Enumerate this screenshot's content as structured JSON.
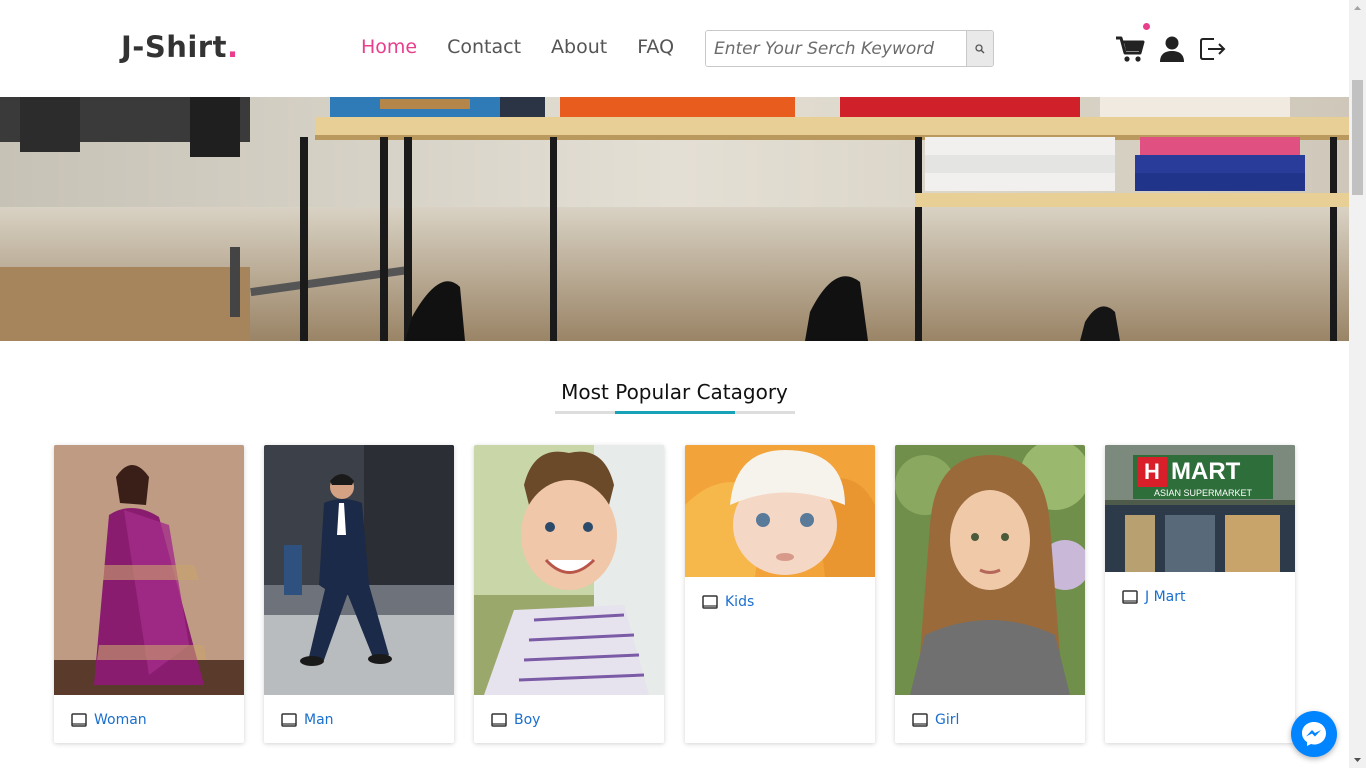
{
  "header": {
    "logo_text": "J-Shirt",
    "logo_dot": ".",
    "nav": [
      {
        "label": "Home",
        "active": true
      },
      {
        "label": "Contact",
        "active": false
      },
      {
        "label": "About",
        "active": false
      },
      {
        "label": "FAQ",
        "active": false
      }
    ],
    "search_placeholder": "Enter Your Serch Keyword",
    "icons": [
      "cart-icon",
      "user-icon",
      "logout-icon",
      "search-icon"
    ]
  },
  "section": {
    "title": "Most Popular Catagory"
  },
  "categories": [
    {
      "label": "Woman",
      "icon": "book-icon"
    },
    {
      "label": "Man",
      "icon": "book-icon"
    },
    {
      "label": "Boy",
      "icon": "book-icon"
    },
    {
      "label": "Kids",
      "icon": "book-icon"
    },
    {
      "label": "Girl",
      "icon": "book-icon"
    },
    {
      "label": "J Mart",
      "icon": "book-icon"
    }
  ],
  "store_sign": {
    "logo_letter": "H",
    "name": "MART",
    "tagline": "ASIAN SUPERMARKET"
  },
  "colors": {
    "accent_pink": "#e83e8c",
    "accent_teal": "#17a2b8",
    "link_blue": "#1a6fcf",
    "messenger_blue": "#0084ff"
  },
  "widgets": {
    "messenger": "messenger-icon"
  }
}
